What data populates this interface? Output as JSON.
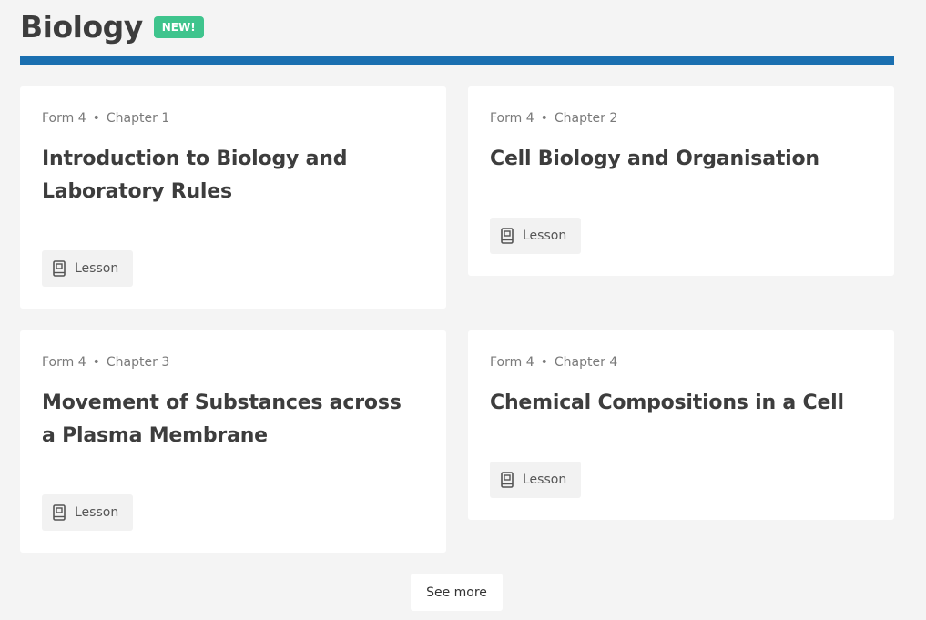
{
  "header": {
    "title": "Biology",
    "badge": "NEW!"
  },
  "colors": {
    "accent_bar": "#1a6fb0",
    "badge": "#3fc48d",
    "background": "#f4f4f4"
  },
  "cards": [
    {
      "form": "Form 4",
      "chapter": "Chapter 1",
      "title": "Introduction to Biology and Laboratory Rules",
      "button_label": "Lesson",
      "button_icon": "book-icon"
    },
    {
      "form": "Form 4",
      "chapter": "Chapter 2",
      "title": "Cell Biology and Organisation",
      "button_label": "Lesson",
      "button_icon": "book-icon"
    },
    {
      "form": "Form 4",
      "chapter": "Chapter 3",
      "title": "Movement of Substances across a Plasma Membrane",
      "button_label": "Lesson",
      "button_icon": "book-icon"
    },
    {
      "form": "Form 4",
      "chapter": "Chapter 4",
      "title": "Chemical Compositions in a Cell",
      "button_label": "Lesson",
      "button_icon": "book-icon"
    }
  ],
  "separator": "•",
  "see_more_label": "See more"
}
